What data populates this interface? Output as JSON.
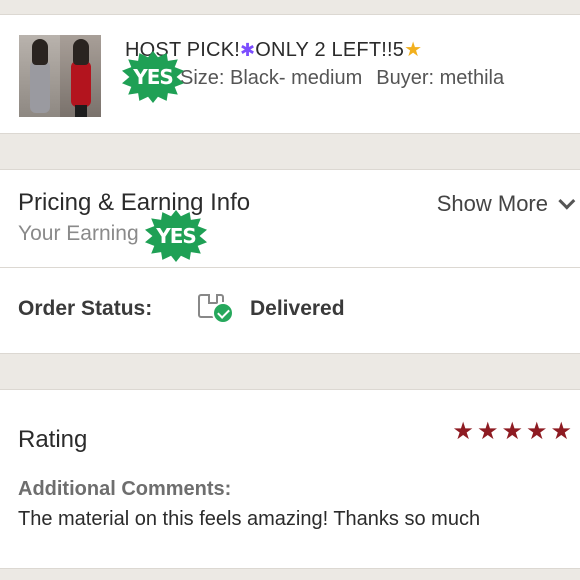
{
  "item": {
    "title_part1": "HOST PICK!",
    "title_confetti_icon": "party-popper-icon",
    "title_part2": "ONLY 2 LEFT!!5",
    "title_star_icon": "star-icon",
    "size": "Size: Black- medium",
    "buyer": "Buyer: methila",
    "thumbnail_icon": "dress-product-image"
  },
  "stickers": {
    "yes_text": "YES",
    "color": "#1fa055"
  },
  "pricing": {
    "title": "Pricing & Earning Info",
    "subtitle": "Your Earning",
    "show_more": "Show More"
  },
  "order": {
    "label": "Order Status:",
    "value": "Delivered",
    "icon": "delivered-box-icon"
  },
  "rating": {
    "label": "Rating",
    "stars": 5,
    "star_color": "#8e1b22",
    "comments_label": "Additional Comments:",
    "comments_text": "The material on this feels amazing! Thanks so much"
  },
  "colors": {
    "background": "#ece9e4",
    "card": "#ffffff",
    "success": "#26a85c"
  }
}
